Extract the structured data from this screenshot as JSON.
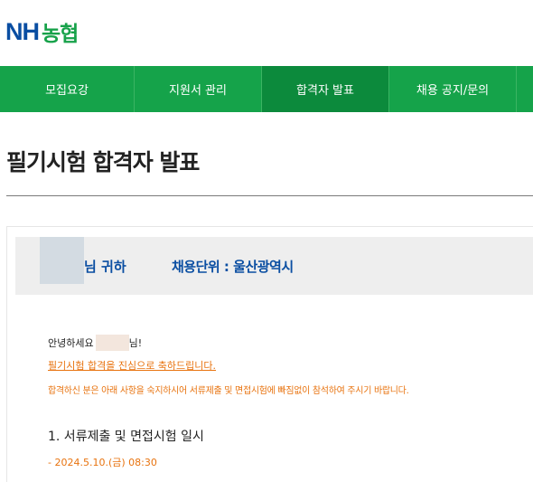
{
  "brand": {
    "nh": "NH",
    "korean": "농협"
  },
  "nav": {
    "items": [
      {
        "label": "모집요강",
        "active": false
      },
      {
        "label": "지원서 관리",
        "active": false
      },
      {
        "label": "합격자 발표",
        "active": true
      },
      {
        "label": "채용 공지/문의",
        "active": false
      }
    ]
  },
  "page": {
    "title": "필기시험 합격자 발표"
  },
  "panel": {
    "name_suffix": "님 귀하",
    "unit": "채용단위 : 울산광역시"
  },
  "body": {
    "greeting_prefix": "안녕하세요",
    "greeting_suffix": "님!",
    "congrats": "필기시험 합격을 진심으로 축하드립니다.",
    "notice": "합격하신 분은 아래 사항을 숙지하시어 서류제출 및 면접시험에 빠짐없이 참석하여 주시기 바랍니다.",
    "section_title": "1. 서류제출 및 면접시험 일시",
    "schedule": "- 2024.5.10.(금) 08:30"
  },
  "colors": {
    "brand_blue": "#0a4ea2",
    "brand_green": "#15a34a",
    "nav_active": "#0c8a3c",
    "accent_orange": "#e8730f"
  }
}
